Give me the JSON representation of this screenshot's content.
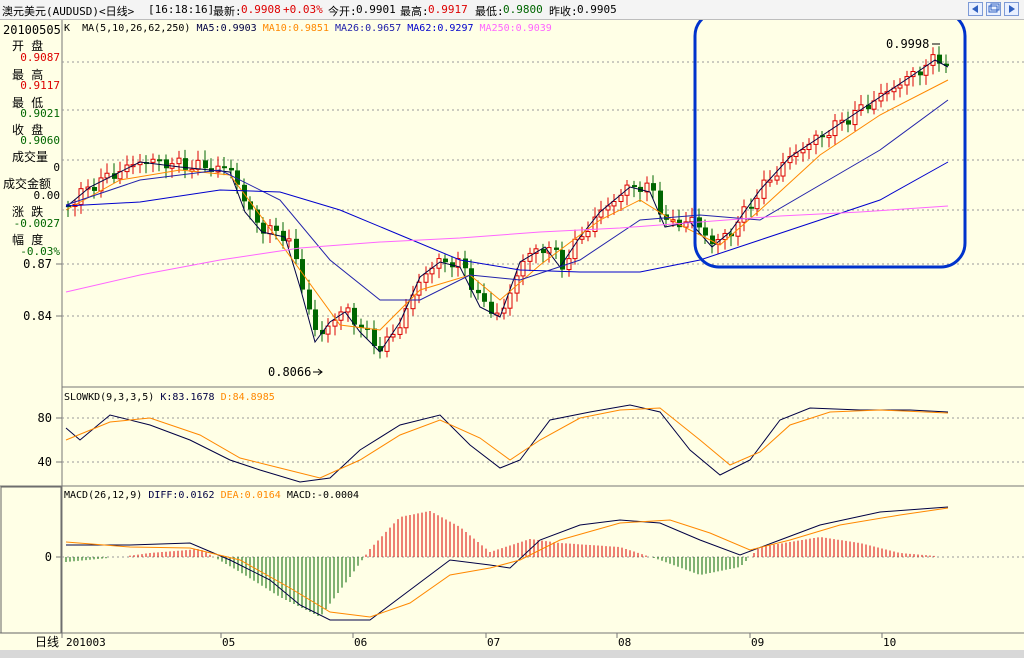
{
  "title": {
    "name": "澳元美元(AUDUSD)<日线>",
    "time": "[16:18:16]",
    "latest_label": "最新:",
    "latest_value": "0.9908",
    "change": "+0.03%",
    "open_label": "今开:",
    "open_value": "0.9901",
    "high_label": "最高:",
    "high_value": "0.9917",
    "low_label": "最低:",
    "low_value": "0.9800",
    "prev_label": "昨收:",
    "prev_value": "0.9905"
  },
  "info": {
    "date": "20100505",
    "open_label": "开  盘",
    "open": "0.9087",
    "high_label": "最  高",
    "high": "0.9117",
    "low_label": "最  低",
    "low": "0.9021",
    "close_label": "收  盘",
    "close": "0.9060",
    "volume_label": "成交量",
    "volume": "0",
    "amount_label": "成交金额",
    "amount": "0.00",
    "change_label": "涨  跌",
    "change": "-0.0027",
    "pct_label": "幅  度",
    "pct": "-0.03%"
  },
  "ma_legend": {
    "k": "K",
    "params": "MA(5,10,26,62,250)",
    "ma5": "MA5:0.9903",
    "ma10": "MA10:0.9851",
    "ma26": "MA26:0.9657",
    "ma62": "MA62:0.9297",
    "ma250": "MA250:0.9039"
  },
  "kd_legend": {
    "name": "SLOWKD(9,3,3,5)",
    "k": "K:83.1678",
    "d": "D:84.8985"
  },
  "macd_legend": {
    "name": "MACD(26,12,9)",
    "diff": "DIFF:0.0162",
    "dea": "DEA:0.0164",
    "macd": "MACD:-0.0004"
  },
  "axis": {
    "price_ticks": [
      "0.87",
      "0.84"
    ],
    "kd_ticks": [
      "80",
      "40"
    ],
    "macd_ticks": [
      "0"
    ],
    "period_label": "日线",
    "months": [
      "201003",
      "05",
      "06",
      "07",
      "08",
      "09",
      "10"
    ]
  },
  "annotations": {
    "high": "0.9998",
    "low": "0.8066"
  },
  "colors": {
    "background": "#ffffe6",
    "up": "#dd0000",
    "down": "#006600",
    "ma5": "#000044",
    "ma10": "#ff8800",
    "ma26": "#2222aa",
    "ma62": "#0000cc",
    "ma250": "#ff66ff",
    "highlight": "#0033cc"
  },
  "chart_data": {
    "type": "line",
    "title": "澳元美元(AUDUSD)<日线>",
    "x": [
      "201003",
      "05",
      "06",
      "07",
      "08",
      "09",
      "10"
    ],
    "series": [
      {
        "name": "MA5",
        "values": [
          0.905,
          0.908,
          0.87,
          0.87,
          0.89,
          0.885,
          0.965,
          0.99
        ]
      },
      {
        "name": "MA10",
        "values": [
          0.903,
          0.908,
          0.88,
          0.866,
          0.885,
          0.885,
          0.955,
          0.985
        ]
      },
      {
        "name": "MA26",
        "values": [
          0.895,
          0.905,
          0.895,
          0.865,
          0.868,
          0.88,
          0.93,
          0.966
        ]
      },
      {
        "name": "MA62",
        "values": [
          0.895,
          0.9,
          0.895,
          0.875,
          0.87,
          0.88,
          0.9,
          0.93
        ]
      },
      {
        "name": "MA250",
        "values": [
          0.867,
          0.877,
          0.885,
          0.885,
          0.888,
          0.89,
          0.898,
          0.904
        ]
      }
    ],
    "ylim": [
      0.8,
      1.01
    ]
  }
}
